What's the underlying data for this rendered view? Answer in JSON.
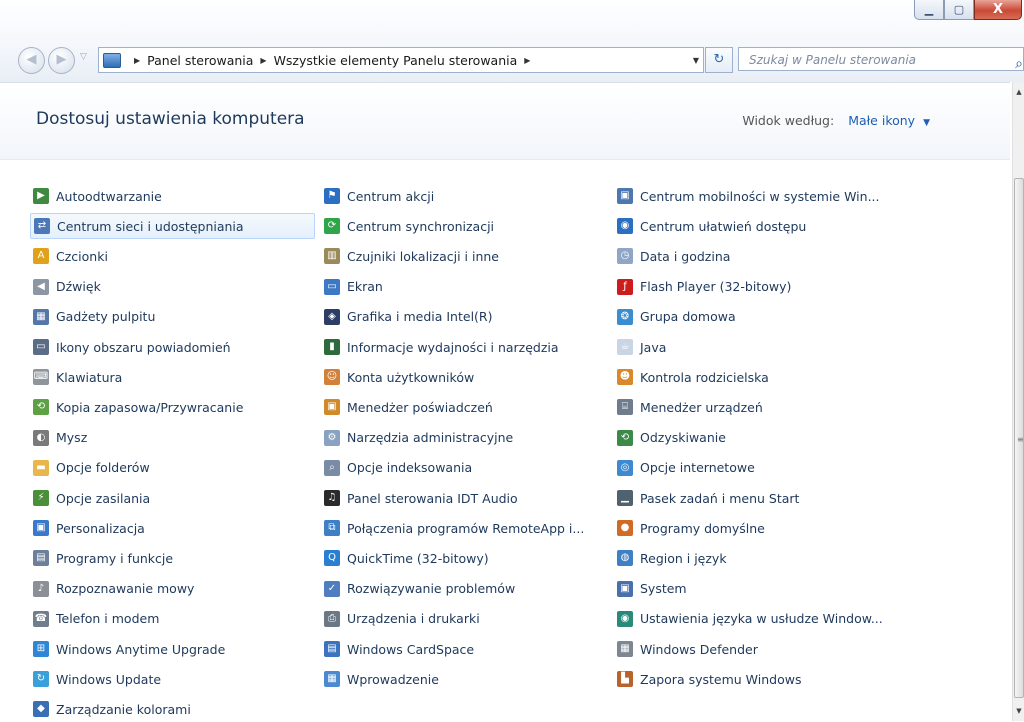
{
  "window": {
    "min_glyph": "▁",
    "max_glyph": "▢",
    "close_glyph": "X"
  },
  "nav": {
    "back_glyph": "◀",
    "forward_glyph": "▶",
    "breadcrumb": [
      "Panel sterowania",
      "Wszystkie elementy Panelu sterowania"
    ],
    "search_placeholder": "Szukaj w Panelu sterowania"
  },
  "page": {
    "title": "Dostosuj ustawienia komputera",
    "view_by_label": "Widok według:",
    "view_by_value": "Małe ikony"
  },
  "items": [
    [
      {
        "label": "Autoodtwarzanie",
        "icon": "autoplay-icon",
        "color": "#3f8a3f",
        "glyph": "▶"
      },
      {
        "label": "Centrum sieci i udostępniania",
        "icon": "network-icon",
        "color": "#4a78b8",
        "glyph": "⇄",
        "selected": true
      },
      {
        "label": "Czcionki",
        "icon": "fonts-icon",
        "color": "#e0a21c",
        "glyph": "A"
      },
      {
        "label": "Dźwięk",
        "icon": "speaker-icon",
        "color": "#8d96a3",
        "glyph": "◀"
      },
      {
        "label": "Gadżety pulpitu",
        "icon": "gadgets-icon",
        "color": "#5577a8",
        "glyph": "▦"
      },
      {
        "label": "Ikony obszaru powiadomień",
        "icon": "notification-icon",
        "color": "#5b6c86",
        "glyph": "▭"
      },
      {
        "label": "Klawiatura",
        "icon": "keyboard-icon",
        "color": "#8f959c",
        "glyph": "⌨"
      },
      {
        "label": "Kopia zapasowa/Przywracanie",
        "icon": "backup-icon",
        "color": "#5ea145",
        "glyph": "⟲"
      },
      {
        "label": "Mysz",
        "icon": "mouse-icon",
        "color": "#7a7a7a",
        "glyph": "◐"
      },
      {
        "label": "Opcje folderów",
        "icon": "folder-icon",
        "color": "#e8b64a",
        "glyph": "▬"
      },
      {
        "label": "Opcje zasilania",
        "icon": "power-icon",
        "color": "#4c8f3a",
        "glyph": "⚡"
      },
      {
        "label": "Personalizacja",
        "icon": "personalize-icon",
        "color": "#3a79c9",
        "glyph": "▣"
      },
      {
        "label": "Programy i funkcje",
        "icon": "programs-icon",
        "color": "#6d7f99",
        "glyph": "▤"
      },
      {
        "label": "Rozpoznawanie mowy",
        "icon": "microphone-icon",
        "color": "#8b8f96",
        "glyph": "♪"
      },
      {
        "label": "Telefon i modem",
        "icon": "phone-icon",
        "color": "#6f7d8c",
        "glyph": "☎"
      },
      {
        "label": "Windows Anytime Upgrade",
        "icon": "windows-flag-icon",
        "color": "#2f86d6",
        "glyph": "⊞"
      },
      {
        "label": "Windows Update",
        "icon": "windows-update-icon",
        "color": "#3aa0d9",
        "glyph": "↻"
      },
      {
        "label": "Zarządzanie kolorami",
        "icon": "color-management-icon",
        "color": "#3a6fb5",
        "glyph": "◆"
      }
    ],
    [
      {
        "label": "Centrum akcji",
        "icon": "action-center-flag-icon",
        "color": "#2a6fc2",
        "glyph": "⚑"
      },
      {
        "label": "Centrum synchronizacji",
        "icon": "sync-icon",
        "color": "#2fa54a",
        "glyph": "⟳"
      },
      {
        "label": "Czujniki lokalizacji i inne",
        "icon": "sensors-icon",
        "color": "#9a8a5a",
        "glyph": "▥"
      },
      {
        "label": "Ekran",
        "icon": "display-icon",
        "color": "#3d78c4",
        "glyph": "▭"
      },
      {
        "label": "Grafika i media Intel(R)",
        "icon": "intel-graphics-icon",
        "color": "#2c3e66",
        "glyph": "◈"
      },
      {
        "label": "Informacje wydajności i narzędzia",
        "icon": "performance-icon",
        "color": "#2e6b3c",
        "glyph": "▮"
      },
      {
        "label": "Konta użytkowników",
        "icon": "user-accounts-icon",
        "color": "#d2813a",
        "glyph": "☺"
      },
      {
        "label": "Menedżer poświadczeń",
        "icon": "credential-icon",
        "color": "#d08a2a",
        "glyph": "▣"
      },
      {
        "label": "Narzędzia administracyjne",
        "icon": "admin-tools-icon",
        "color": "#8aa2c2",
        "glyph": "⚙"
      },
      {
        "label": "Opcje indeksowania",
        "icon": "indexing-icon",
        "color": "#7a8ba6",
        "glyph": "⌕"
      },
      {
        "label": "Panel sterowania IDT Audio",
        "icon": "idt-audio-icon",
        "color": "#2b2b2b",
        "glyph": "♫"
      },
      {
        "label": "Połączenia programów RemoteApp i...",
        "icon": "remoteapp-icon",
        "color": "#3f7fc6",
        "glyph": "⧉"
      },
      {
        "label": "QuickTime (32-bitowy)",
        "icon": "quicktime-icon",
        "color": "#2a7fd1",
        "glyph": "Q"
      },
      {
        "label": "Rozwiązywanie problemów",
        "icon": "troubleshoot-icon",
        "color": "#4f7dbd",
        "glyph": "✓"
      },
      {
        "label": "Urządzenia i drukarki",
        "icon": "printer-icon",
        "color": "#6b7886",
        "glyph": "⎙"
      },
      {
        "label": "Windows CardSpace",
        "icon": "cardspace-icon",
        "color": "#3c73c0",
        "glyph": "▤"
      },
      {
        "label": "Wprowadzenie",
        "icon": "getting-started-icon",
        "color": "#4c8ad0",
        "glyph": "▦"
      }
    ],
    [
      {
        "label": "Centrum mobilności w systemie Win...",
        "icon": "mobility-center-icon",
        "color": "#4c78b0",
        "glyph": "▣"
      },
      {
        "label": "Centrum ułatwień dostępu",
        "icon": "ease-of-access-icon",
        "color": "#2c6fc0",
        "glyph": "◉"
      },
      {
        "label": "Data i godzina",
        "icon": "clock-icon",
        "color": "#8fa6c6",
        "glyph": "◷"
      },
      {
        "label": "Flash Player (32-bitowy)",
        "icon": "flash-player-icon",
        "color": "#cc1c1c",
        "glyph": "ƒ"
      },
      {
        "label": "Grupa domowa",
        "icon": "homegroup-icon",
        "color": "#3a8ed0",
        "glyph": "❂"
      },
      {
        "label": "Java",
        "icon": "java-icon",
        "color": "#c9d4e4",
        "glyph": "☕"
      },
      {
        "label": "Kontrola rodzicielska",
        "icon": "parental-controls-icon",
        "color": "#d9882b",
        "glyph": "☻"
      },
      {
        "label": "Menedżer urządzeń",
        "icon": "device-manager-icon",
        "color": "#6e7c8d",
        "glyph": "⌸"
      },
      {
        "label": "Odzyskiwanie",
        "icon": "recovery-icon",
        "color": "#3c8a48",
        "glyph": "⟲"
      },
      {
        "label": "Opcje internetowe",
        "icon": "internet-options-icon",
        "color": "#3d8ad0",
        "glyph": "◎"
      },
      {
        "label": "Pasek zadań i menu Start",
        "icon": "taskbar-icon",
        "color": "#51626f",
        "glyph": "▁"
      },
      {
        "label": "Programy domyślne",
        "icon": "default-programs-icon",
        "color": "#d06a24",
        "glyph": "●"
      },
      {
        "label": "Region i język",
        "icon": "region-language-icon",
        "color": "#3f7fc3",
        "glyph": "◍"
      },
      {
        "label": "System",
        "icon": "system-icon",
        "color": "#4a70ac",
        "glyph": "▣"
      },
      {
        "label": "Ustawienia języka w usłudze Window...",
        "icon": "language-settings-icon",
        "color": "#2a8a7a",
        "glyph": "◉"
      },
      {
        "label": "Windows Defender",
        "icon": "windows-defender-icon",
        "color": "#7d8791",
        "glyph": "▦"
      },
      {
        "label": "Zapora systemu Windows",
        "icon": "firewall-icon",
        "color": "#b8632b",
        "glyph": "▙"
      }
    ]
  ]
}
